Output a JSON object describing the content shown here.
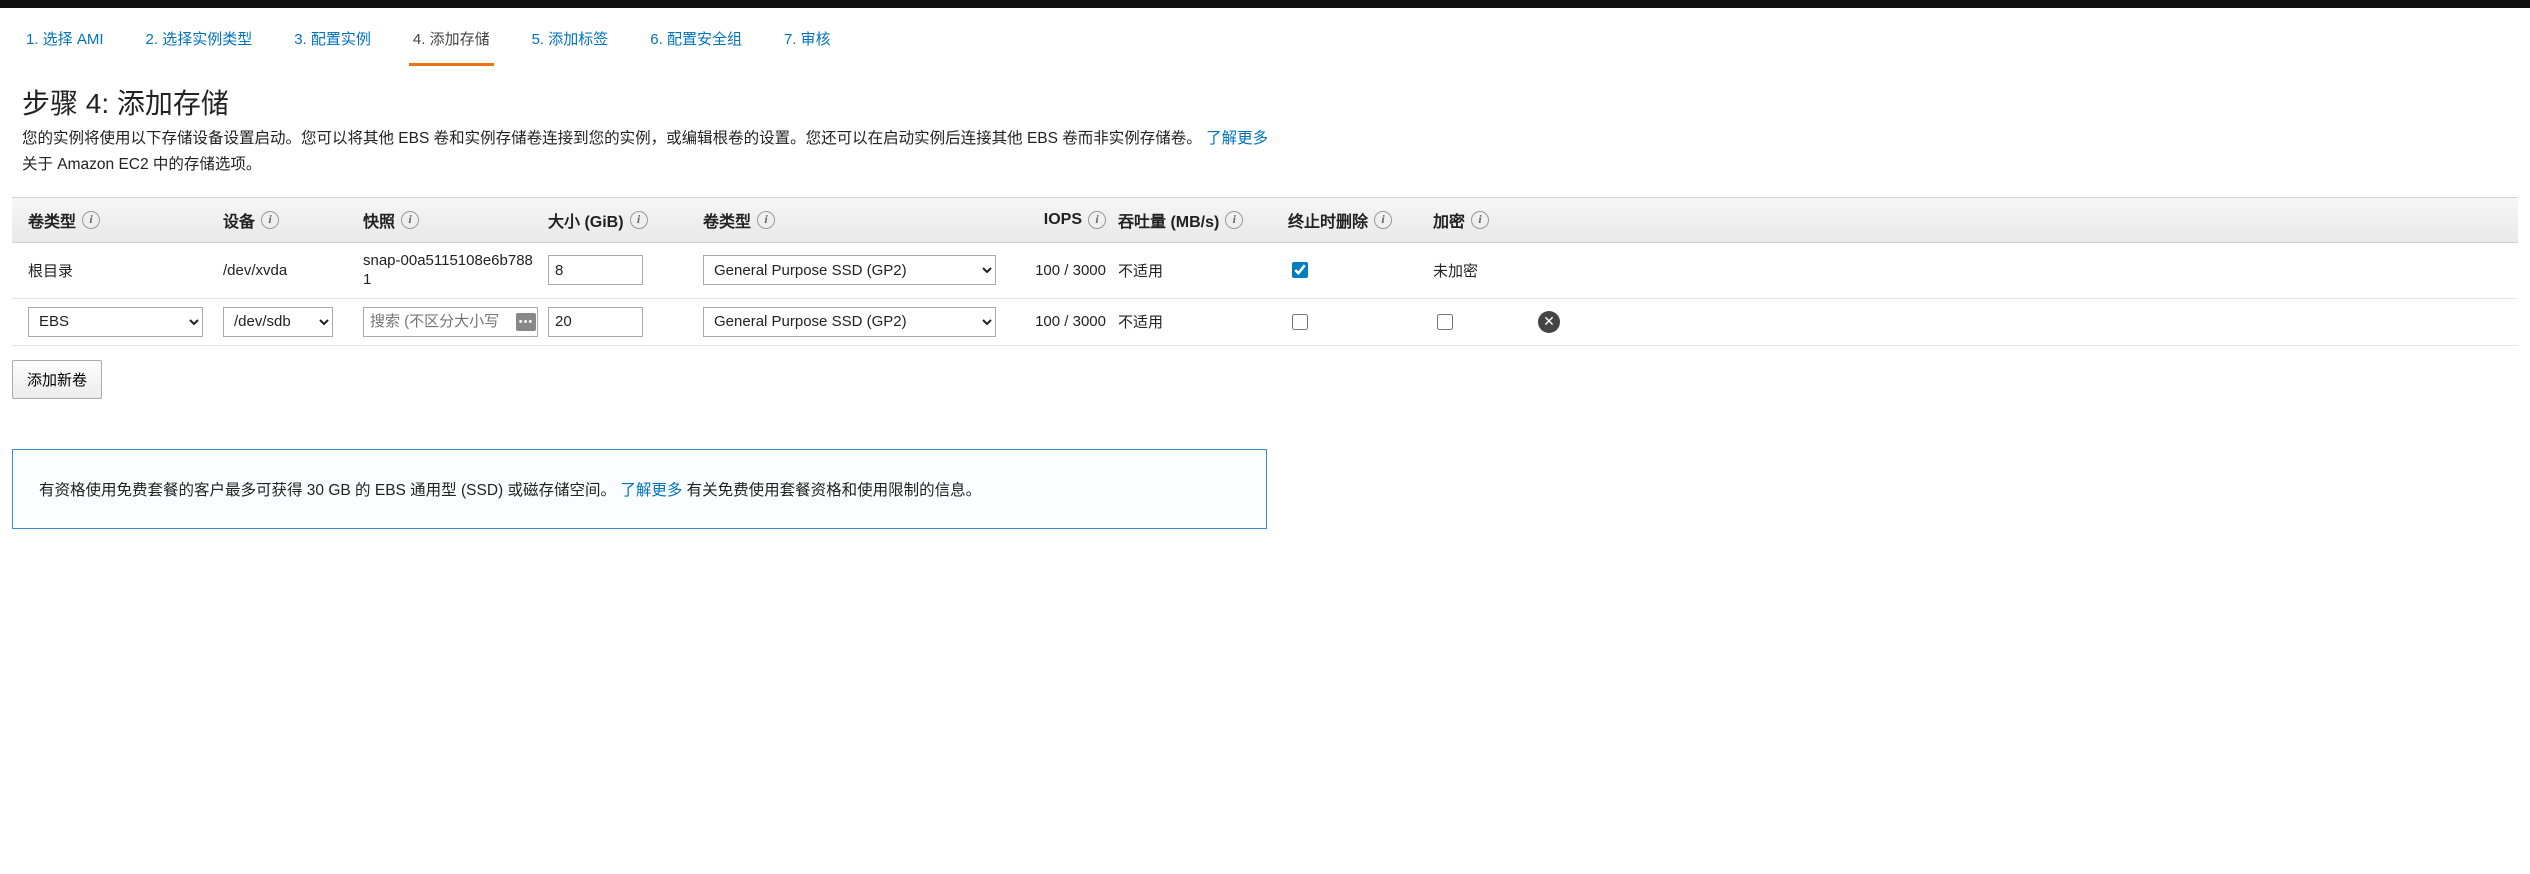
{
  "tabs": [
    {
      "label": "1. 选择 AMI"
    },
    {
      "label": "2. 选择实例类型"
    },
    {
      "label": "3. 配置实例"
    },
    {
      "label": "4. 添加存储",
      "active": true
    },
    {
      "label": "5. 添加标签"
    },
    {
      "label": "6. 配置安全组"
    },
    {
      "label": "7. 审核"
    }
  ],
  "title": "步骤 4: 添加存储",
  "descPre": "您的实例将使用以下存储设备设置启动。您可以将其他 EBS 卷和实例存储卷连接到您的实例，或编辑根卷的设置。您还可以在启动实例后连接其他 EBS 卷而非实例存储卷。",
  "descLink": "了解更多",
  "descPost": " 关于 Amazon EC2 中的存储选项。",
  "headers": {
    "voltype1": "卷类型",
    "device": "设备",
    "snapshot": "快照",
    "size": "大小 (GiB)",
    "voltype2": "卷类型",
    "iops": "IOPS",
    "throughput": "吞吐量 (MB/s)",
    "delterm": "终止时删除",
    "encrypt": "加密"
  },
  "row1": {
    "voltype": "根目录",
    "device": "/dev/xvda",
    "snapshot": "snap-00a5115108e6b7881",
    "size": "8",
    "voltype2": "General Purpose SSD (GP2)",
    "iops": "100 / 3000",
    "throughput": "不适用",
    "delterm": true,
    "encrypt": "未加密"
  },
  "row2": {
    "voltype": "EBS",
    "device": "/dev/sdb",
    "snapshotPlaceholder": "搜索 (不区分大小写",
    "size": "20",
    "voltype2": "General Purpose SSD (GP2)",
    "iops": "100 / 3000",
    "throughput": "不适用",
    "delterm": false,
    "encrypt": false
  },
  "addBtn": "添加新卷",
  "notice": {
    "pre": "有资格使用免费套餐的客户最多可获得 30 GB 的 EBS 通用型 (SSD) 或磁存储空间。",
    "link": "了解更多",
    "post": " 有关免费使用套餐资格和使用限制的信息。"
  }
}
